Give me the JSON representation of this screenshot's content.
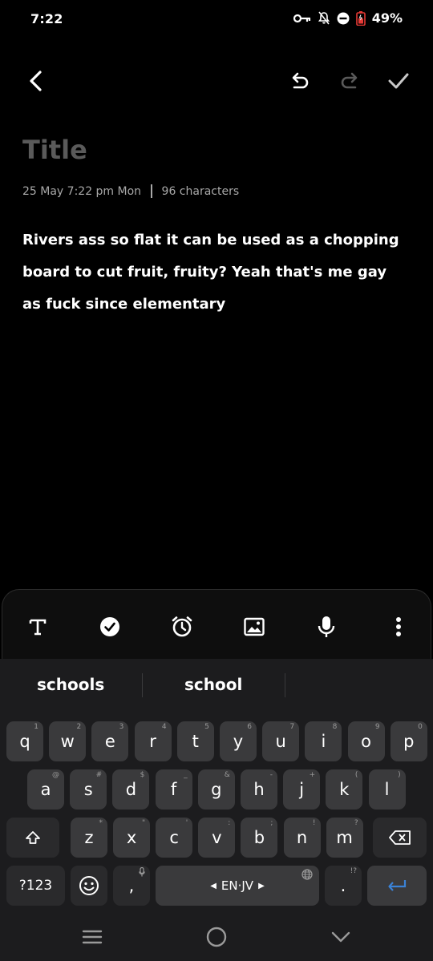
{
  "status": {
    "time": "7:22",
    "battery": "49%"
  },
  "note": {
    "title_placeholder": "Title",
    "date": "25 May 7:22 pm Mon",
    "chars": "96 characters",
    "body": "Rivers ass so flat it can be used as a chopping board to cut fruit, fruity? Yeah that's me gay as fuck since elementary"
  },
  "toolbar": {
    "icons": [
      "back-icon",
      "undo-icon",
      "redo-icon",
      "check-icon"
    ]
  },
  "format_bar": {
    "icons": [
      "text-style-icon",
      "checkbox-icon",
      "alarm-icon",
      "image-icon",
      "mic-icon",
      "more-icon"
    ]
  },
  "keyboard": {
    "suggestions": [
      "schools",
      "school"
    ],
    "row1": [
      [
        "q",
        "1"
      ],
      [
        "w",
        "2"
      ],
      [
        "e",
        "3"
      ],
      [
        "r",
        "4"
      ],
      [
        "t",
        "5"
      ],
      [
        "y",
        "6"
      ],
      [
        "u",
        "7"
      ],
      [
        "i",
        "8"
      ],
      [
        "o",
        "9"
      ],
      [
        "p",
        "0"
      ]
    ],
    "row2": [
      [
        "a",
        "@"
      ],
      [
        "s",
        "#"
      ],
      [
        "d",
        "$"
      ],
      [
        "f",
        "_"
      ],
      [
        "g",
        "&"
      ],
      [
        "h",
        "-"
      ],
      [
        "j",
        "+"
      ],
      [
        "k",
        "("
      ],
      [
        "l",
        ")"
      ]
    ],
    "row3": [
      [
        "z",
        "*"
      ],
      [
        "x",
        "\""
      ],
      [
        "c",
        "'"
      ],
      [
        "v",
        ":"
      ],
      [
        "b",
        ";"
      ],
      [
        "n",
        "!"
      ],
      [
        "m",
        "?"
      ]
    ],
    "symbols_label": "?123",
    "comma": ",",
    "space_label": "EN·JV",
    "period": ".",
    "period_hint": "!?"
  },
  "colors": {
    "background": "#000000",
    "keyboard": "#1c1c1e",
    "key": "#3a3a3c",
    "accent": "#3b82d6",
    "battery": "#e53935"
  }
}
